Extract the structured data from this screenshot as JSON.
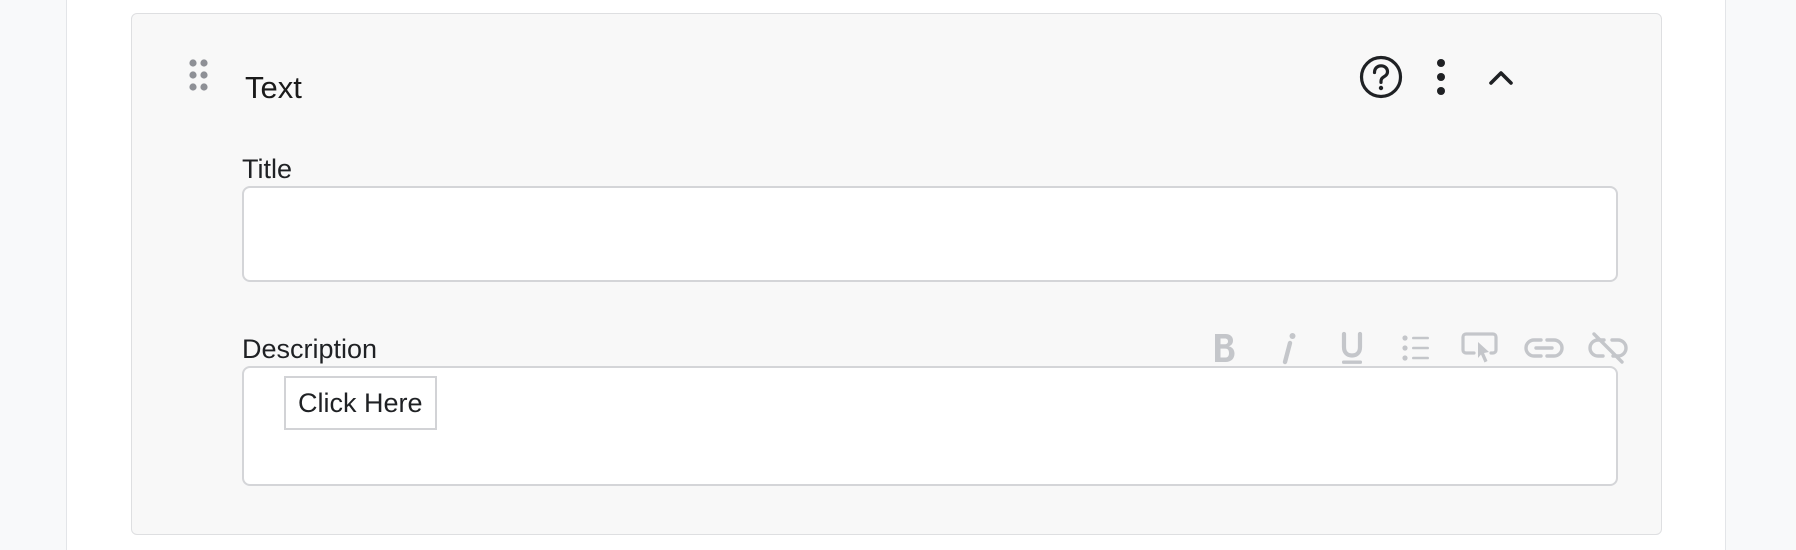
{
  "block": {
    "title": "Text",
    "help_icon": "help-circle-icon",
    "menu_icon": "more-vertical-icon",
    "collapse_icon": "chevron-up-icon",
    "drag_icon": "drag-handle-icon"
  },
  "fields": {
    "title": {
      "label": "Title",
      "value": "",
      "placeholder": ""
    },
    "description": {
      "label": "Description",
      "button_label": "Click Here"
    }
  },
  "toolbar": {
    "items": [
      "bold-icon",
      "italic-icon",
      "underline-icon",
      "bullet-list-icon",
      "button-cursor-icon",
      "link-icon",
      "unlink-icon"
    ],
    "disabled_color": "#c4c6ca"
  },
  "colors": {
    "page_bg": "#f8f9fa",
    "card_bg": "#f8f8f8",
    "border": "#d4d5d8",
    "text": "#1f2124"
  }
}
